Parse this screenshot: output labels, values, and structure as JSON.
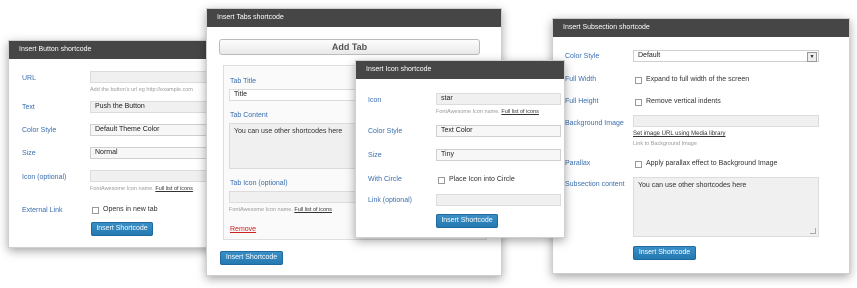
{
  "button_dialog": {
    "title": "Insert Button shortcode",
    "url_label": "URL",
    "url_value": "",
    "url_hint": "Add the button's url eg http://example.com",
    "text_label": "Text",
    "text_value": "Push the Button",
    "color_label": "Color Style",
    "color_value": "Default Theme Color",
    "size_label": "Size",
    "size_value": "Normal",
    "icon_label": "Icon (optional)",
    "icon_value": "",
    "icon_hint": "FontAwesome Icon name.",
    "icon_link": "Full list of icons",
    "external_label": "External Link",
    "external_checkbox": "Opens in new tab",
    "insert_button": "Insert Shortcode"
  },
  "tabs_dialog": {
    "title": "Insert Tabs shortcode",
    "add_tab_button": "Add Tab",
    "tab_title_label": "Tab Title",
    "tab_title_value": "Title",
    "tab_content_label": "Tab Content",
    "tab_content_value": "You can use other shortcodes here",
    "tab_icon_label": "Tab Icon (optional)",
    "tab_icon_value": "",
    "tab_icon_hint": "FontAwesome Icon name.",
    "tab_icon_link": "Full list of icons",
    "remove_link": "Remove",
    "insert_button": "Insert Shortcode"
  },
  "icon_dialog": {
    "title": "Insert Icon shortcode",
    "icon_label": "Icon",
    "icon_value": "star",
    "icon_hint": "FontAwesome Icon name.",
    "icon_link": "Full list of icons",
    "color_label": "Color Style",
    "color_value": "Text Color",
    "size_label": "Size",
    "size_value": "Tiny",
    "circle_label": "With Circle",
    "circle_checkbox": "Place Icon into Circle",
    "link_label": "Link (optional)",
    "link_value": "",
    "insert_button": "Insert Shortcode"
  },
  "subsection_dialog": {
    "title": "Insert Subsection shortcode",
    "color_label": "Color Style",
    "color_value": "Default",
    "fullwidth_label": "Full Width",
    "fullwidth_checkbox": "Expand to full width of the screen",
    "fullheight_label": "Full Height",
    "fullheight_checkbox": "Remove vertical indents",
    "bg_label": "Background Image",
    "bg_value": "",
    "bg_link": "Set image URL using Media library",
    "bg_hint": "Link to Background Image",
    "parallax_label": "Parallax",
    "parallax_checkbox": "Apply parallax effect to Background Image",
    "content_label": "Subsection content",
    "content_value": "You can use other shortcodes here",
    "insert_button": "Insert Shortcode"
  },
  "colors": {
    "titlebar": "#464646",
    "label": "#3a6fb0",
    "button": "#2479b0",
    "remove": "#cc2222"
  }
}
